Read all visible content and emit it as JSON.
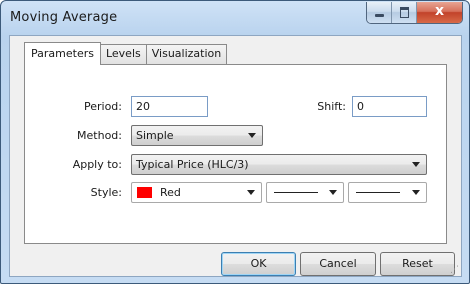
{
  "window": {
    "title": "Moving Average"
  },
  "caption_buttons": {
    "close_glyph": "x"
  },
  "tabs": [
    {
      "label": "Parameters",
      "active": true
    },
    {
      "label": "Levels",
      "active": false
    },
    {
      "label": "Visualization",
      "active": false
    }
  ],
  "form": {
    "period_label": "Period:",
    "period_value": "20",
    "shift_label": "Shift:",
    "shift_value": "0",
    "method_label": "Method:",
    "method_value": "Simple",
    "apply_label": "Apply to:",
    "apply_value": "Typical Price (HLC/3)",
    "style_label": "Style:",
    "style_color_name": "Red",
    "style_color_hex": "#ff0000"
  },
  "buttons": {
    "ok": "OK",
    "cancel": "Cancel",
    "reset": "Reset"
  }
}
